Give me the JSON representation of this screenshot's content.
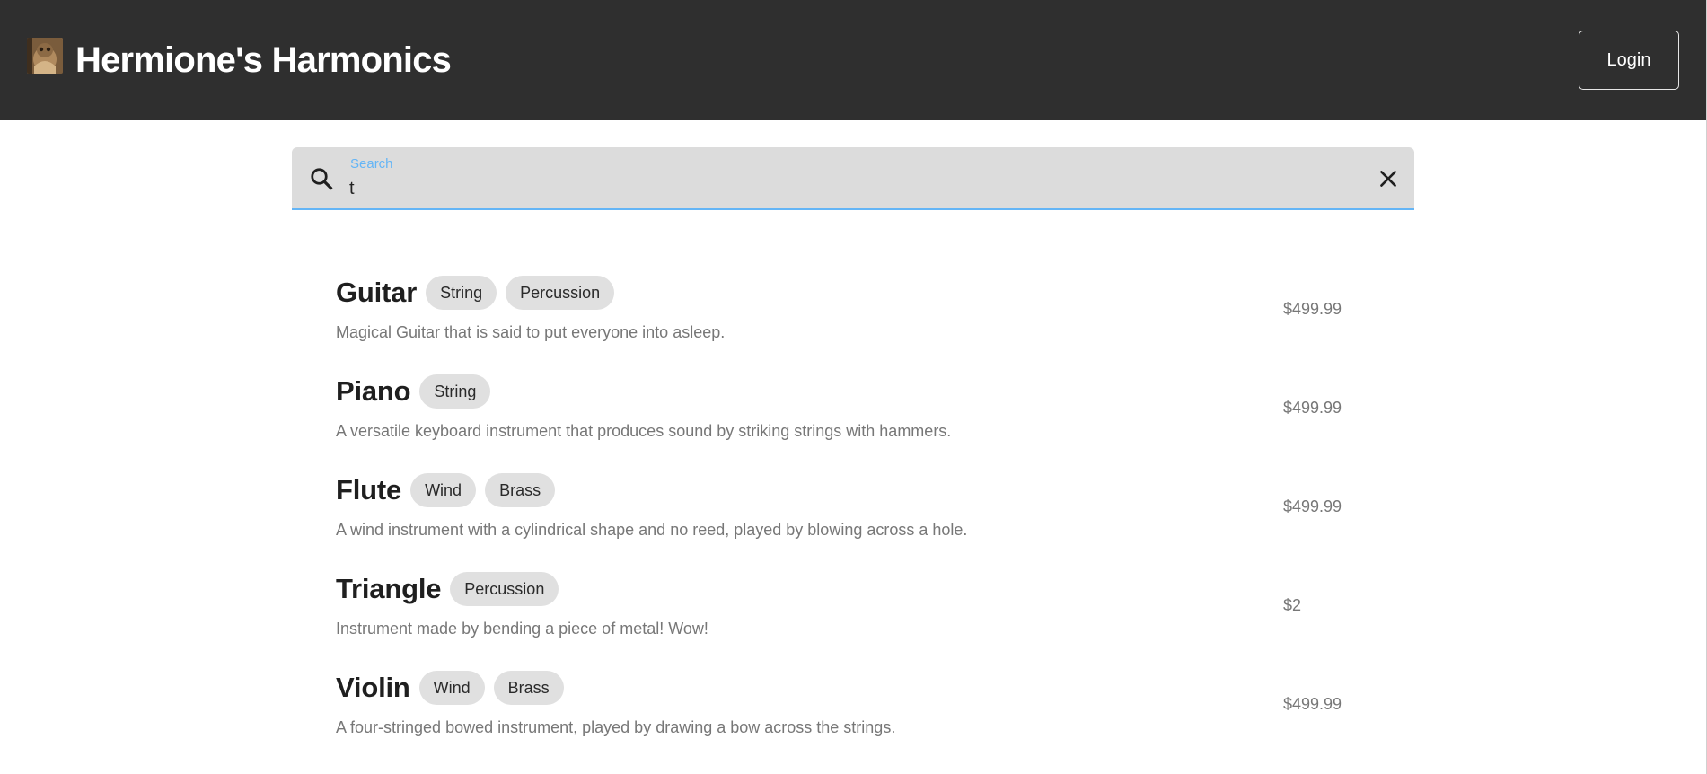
{
  "header": {
    "logo_icon": "owl-photo-logo",
    "title": "Hermione's Harmonics",
    "login_label": "Login",
    "background": "#2f2f2f"
  },
  "search": {
    "label": "Search",
    "value": "t",
    "search_icon": "search-icon",
    "clear_icon": "close-icon",
    "accent": "#64b5f6"
  },
  "results": [
    {
      "name": "Guitar",
      "tags": [
        "String",
        "Percussion"
      ],
      "description": "Magical Guitar that is said to put everyone into asleep.",
      "price": "$499.99"
    },
    {
      "name": "Piano",
      "tags": [
        "String"
      ],
      "description": "A versatile keyboard instrument that produces sound by striking strings with hammers.",
      "price": "$499.99"
    },
    {
      "name": "Flute",
      "tags": [
        "Wind",
        "Brass"
      ],
      "description": "A wind instrument with a cylindrical shape and no reed, played by blowing across a hole.",
      "price": "$499.99"
    },
    {
      "name": "Triangle",
      "tags": [
        "Percussion"
      ],
      "description": "Instrument made by bending a piece of metal! Wow!",
      "price": "$2"
    },
    {
      "name": "Violin",
      "tags": [
        "Wind",
        "Brass"
      ],
      "description": "A four-stringed bowed instrument, played by drawing a bow across the strings.",
      "price": "$499.99"
    }
  ]
}
